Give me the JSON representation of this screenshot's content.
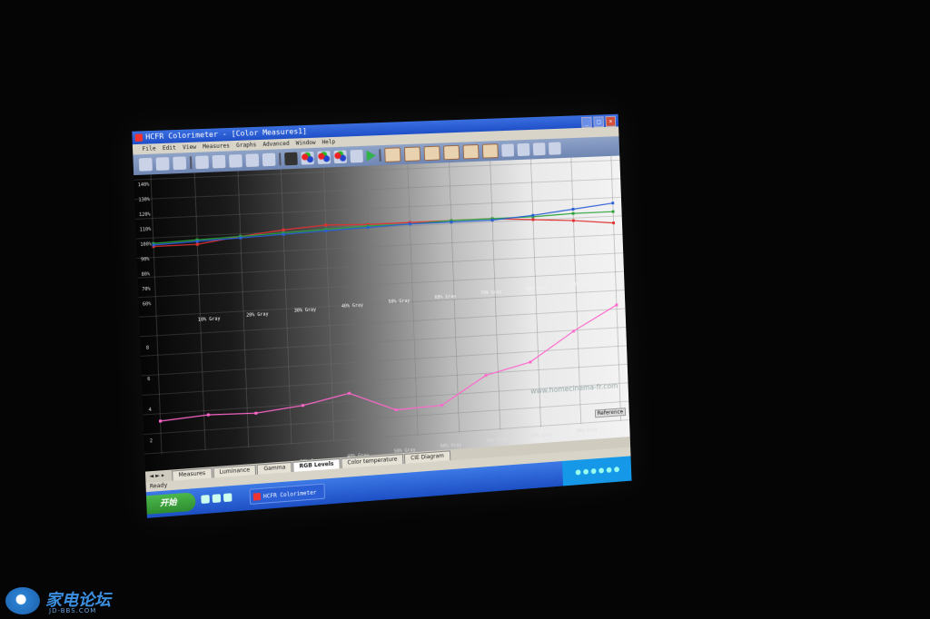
{
  "window": {
    "title": "HCFR Colorimeter - [Color Measures1]"
  },
  "menu": [
    "File",
    "Edit",
    "View",
    "Measures",
    "Graphs",
    "Advanced",
    "Window",
    "Help"
  ],
  "chart_data": {
    "type": "line",
    "ylim_top": [
      60,
      140
    ],
    "ylim_bottom": [
      2,
      8
    ],
    "y_ticks_top": [
      "140%",
      "130%",
      "120%",
      "110%",
      "100%",
      "90%",
      "80%",
      "70%",
      "60%"
    ],
    "y_ticks_bottom": [
      "8",
      "6",
      "4",
      "2"
    ],
    "categories_top": [
      "10% Gray",
      "20% Gray",
      "30% Gray",
      "40% Gray",
      "50% Gray",
      "60% Gray",
      "70% Gray",
      "80% Gray",
      "90% Gray"
    ],
    "categories_bottom": [
      "10% Gray",
      "20% Gray",
      "30% Gray",
      "40% Gray",
      "50% Gray",
      "60% Gray",
      "70% Gray",
      "80% Gray",
      "90% Gray"
    ],
    "series": [
      {
        "color": "#e23030",
        "panel": "top",
        "values": [
          98,
          98,
          102,
          105,
          107,
          106,
          106,
          106,
          106,
          104,
          102,
          99
        ]
      },
      {
        "color": "#2aa33a",
        "panel": "top",
        "values": [
          100,
          101,
          102,
          103,
          104,
          105,
          105,
          106,
          106,
          106,
          107,
          107
        ]
      },
      {
        "color": "#2a5fd6",
        "panel": "top",
        "values": [
          99,
          100,
          101,
          102,
          103,
          104,
          105,
          105,
          105,
          107,
          110,
          113
        ]
      },
      {
        "color": "#ff66cc",
        "panel": "bottom",
        "values": [
          3.2,
          3.4,
          3.3,
          3.6,
          4.2,
          2.9,
          3.0,
          4.8,
          5.5,
          7.4,
          9.0
        ]
      }
    ],
    "legend": "Reference",
    "watermark": "www.homecinema-fr.com"
  },
  "tabs": [
    "Measures",
    "Luminance",
    "Gamma",
    "RGB Levels",
    "Color temperature",
    "CIE Diagram"
  ],
  "active_tab": "RGB Levels",
  "status": "Ready",
  "taskbar": {
    "start_label": "开始",
    "task_label": "HCFR Colorimeter"
  },
  "watermark_logo": {
    "name": "家电论坛",
    "sub": "JD-BBS.COM"
  }
}
